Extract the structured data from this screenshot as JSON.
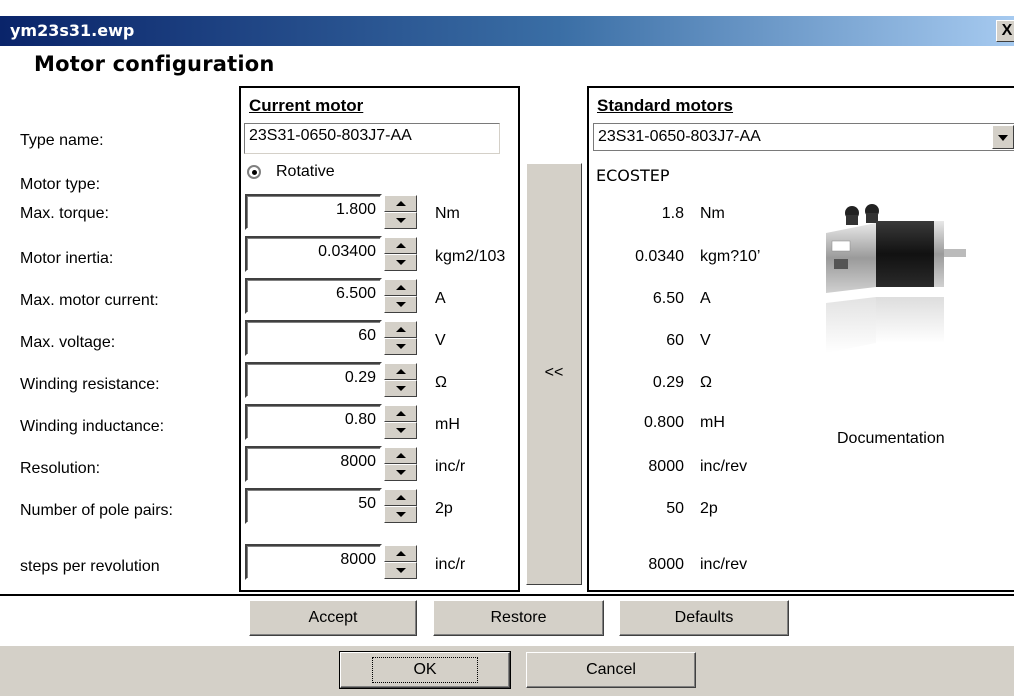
{
  "window": {
    "title": "ym23s31.ewp",
    "close": "X"
  },
  "dialog": {
    "title": "Motor configuration"
  },
  "labels": {
    "type_name": "Type name:",
    "motor_type": "Motor type:",
    "max_torque": "Max. torque:",
    "motor_inertia": "Motor inertia:",
    "max_current": "Max. motor current:",
    "max_voltage": "Max. voltage:",
    "winding_resistance": "Winding resistance:",
    "winding_inductance": "Winding inductance:",
    "resolution": "Resolution:",
    "pole_pairs": "Number of pole pairs:",
    "steps_per_rev": "steps per revolution"
  },
  "current": {
    "header": "Current motor",
    "type_name": "23S31-0650-803J7-AA",
    "motor_type": "Rotative",
    "max_torque": "1.800",
    "max_torque_unit": "Nm",
    "motor_inertia": "0.03400",
    "motor_inertia_unit": "kgm2/103",
    "max_current": "6.500",
    "max_current_unit": "A",
    "max_voltage": "60",
    "max_voltage_unit": "V",
    "winding_resistance": "0.29",
    "winding_resistance_unit": "Ω",
    "winding_inductance": "0.80",
    "winding_inductance_unit": "mH",
    "resolution": "8000",
    "resolution_unit": "inc/r",
    "pole_pairs": "50",
    "pole_pairs_unit": "2p",
    "steps_per_rev": "8000",
    "steps_per_rev_unit": "inc/r"
  },
  "copy_button": "<<",
  "standard": {
    "header": "Standard motors",
    "selected": "23S31-0650-803J7-AA",
    "type": "ECOSTEP",
    "max_torque": "1.8",
    "max_torque_unit": "Nm",
    "motor_inertia": "0.0340",
    "motor_inertia_unit": "kgm?10’",
    "max_current": "6.50",
    "max_current_unit": "A",
    "max_voltage": "60",
    "max_voltage_unit": "V",
    "winding_resistance": "0.29",
    "winding_resistance_unit": "Ω",
    "winding_inductance": "0.800",
    "winding_inductance_unit": "mH",
    "resolution": "8000",
    "resolution_unit": "inc/rev",
    "pole_pairs": "50",
    "pole_pairs_unit": "2p",
    "steps_per_rev": "8000",
    "steps_per_rev_unit": "inc/rev",
    "documentation": "Documentation"
  },
  "buttons": {
    "accept": "Accept",
    "restore": "Restore",
    "defaults": "Defaults",
    "ok": "OK",
    "cancel": "Cancel"
  }
}
